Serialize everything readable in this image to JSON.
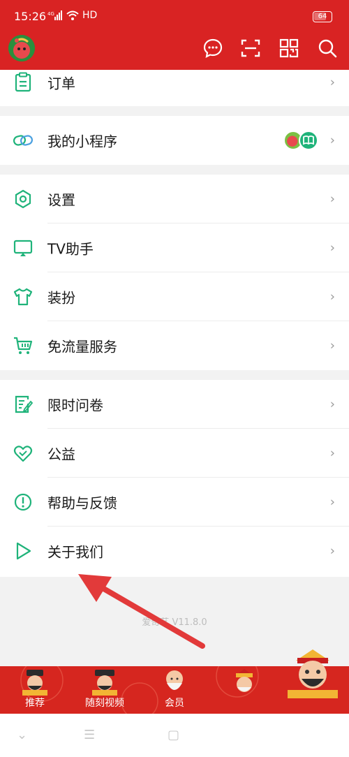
{
  "status_bar": {
    "time": "15:26",
    "network": "4G",
    "hd": "HD",
    "battery": "64"
  },
  "colors": {
    "brand_red": "#d92323",
    "accent_green": "#1fb37a",
    "arrow_red": "#e23a3a"
  },
  "header": {
    "icons": [
      "message-icon",
      "scan-icon",
      "qr-code-icon",
      "search-icon"
    ]
  },
  "menu": {
    "orders": {
      "label": "订单"
    },
    "mini_programs": {
      "label": "我的小程序"
    },
    "settings": {
      "label": "设置"
    },
    "tv_assistant": {
      "label": "TV助手"
    },
    "dress_up": {
      "label": "装扮"
    },
    "free_data": {
      "label": "免流量服务"
    },
    "survey": {
      "label": "限时问卷"
    },
    "charity": {
      "label": "公益"
    },
    "help": {
      "label": "帮助与反馈"
    },
    "about": {
      "label": "关于我们"
    }
  },
  "chevron": "›",
  "version_text": "爱奇艺 V11.8.0",
  "tabs": [
    {
      "label": "推荐"
    },
    {
      "label": "随刻视频"
    },
    {
      "label": "会员"
    }
  ],
  "nav": {
    "back": "⌄",
    "home": "☰",
    "recent": "▢"
  }
}
